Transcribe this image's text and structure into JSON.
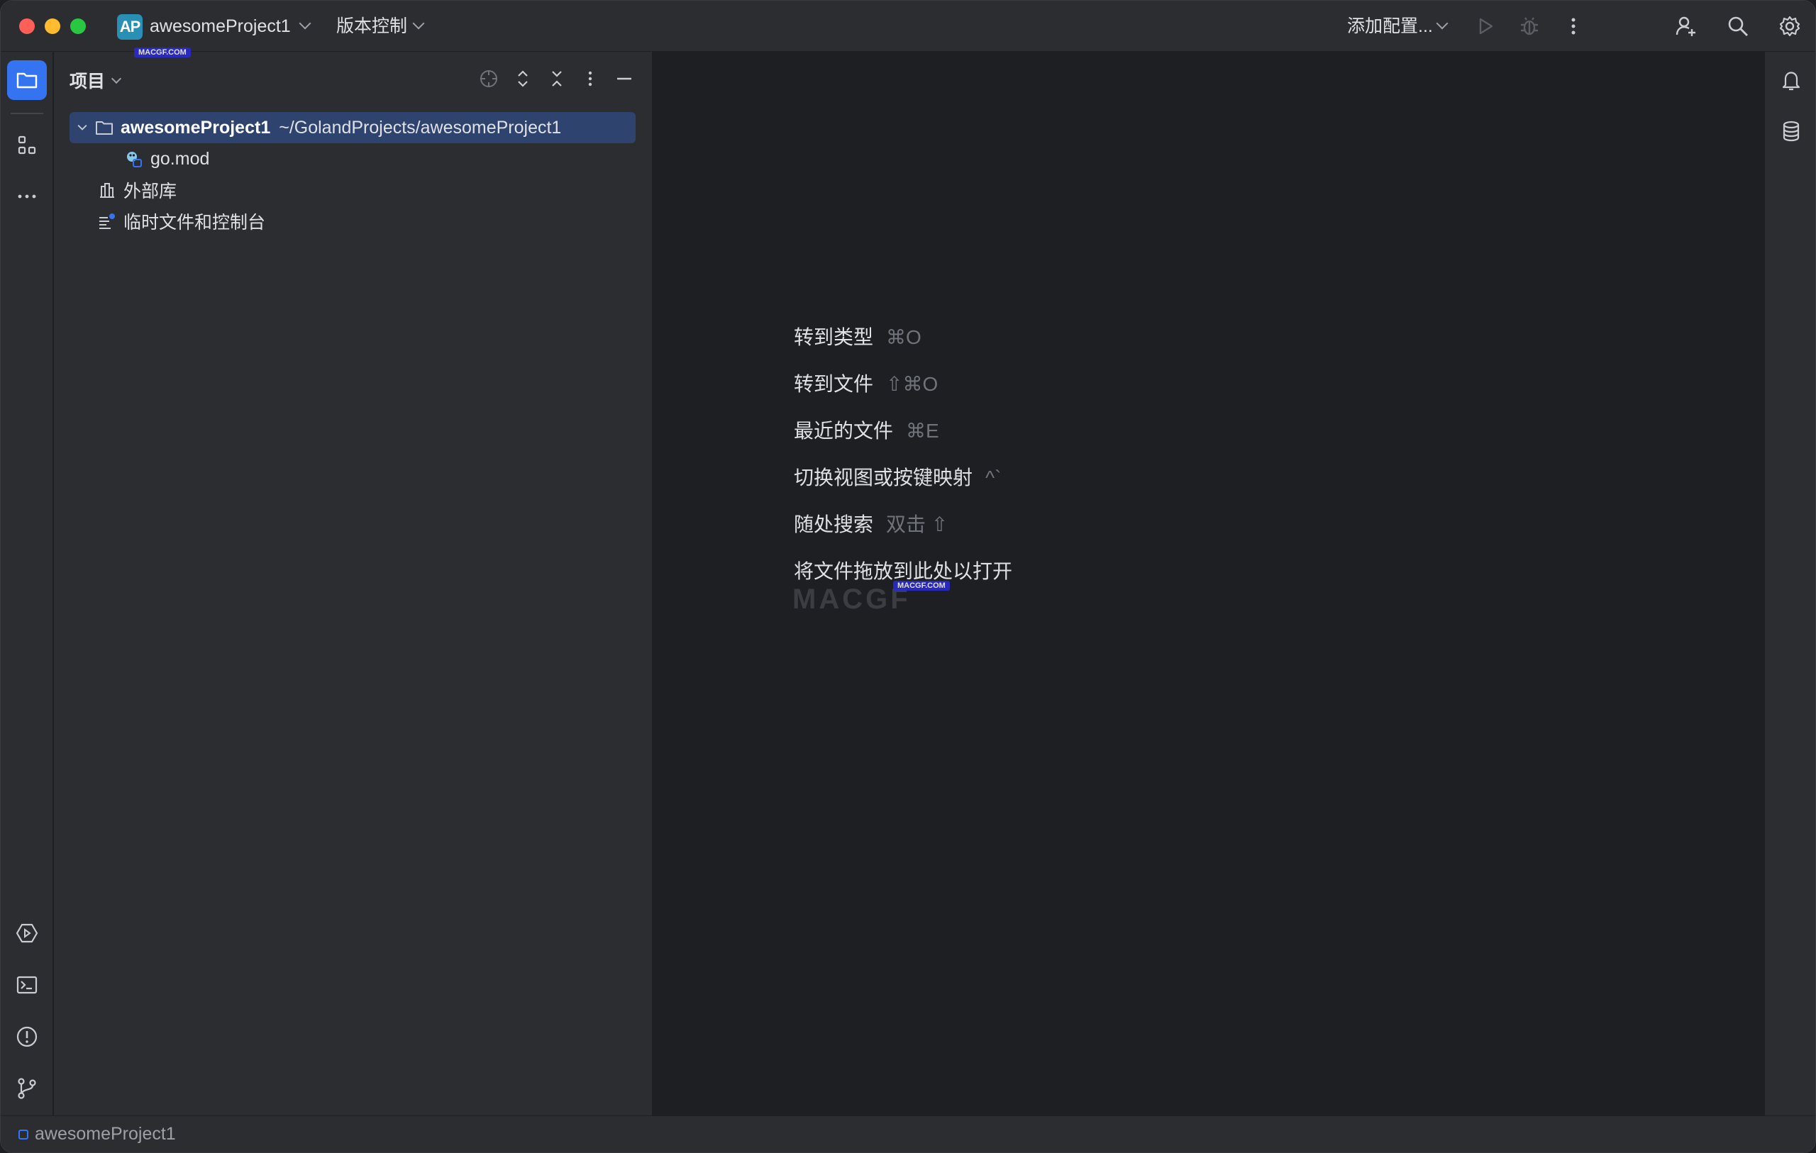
{
  "titlebar": {
    "project_badge": "AP",
    "project_name": "awesomeProject1",
    "vcs_label": "版本控制",
    "run_config": "添加配置..."
  },
  "project_panel": {
    "title": "项目",
    "tree": [
      {
        "name": "awesomeProject1",
        "path": "~/GolandProjects/awesomeProject1",
        "icon": "folder-icon",
        "selected": true
      },
      {
        "name": "go.mod",
        "icon": "go-mod-icon"
      },
      {
        "name": "外部库",
        "icon": "library-icon"
      },
      {
        "name": "临时文件和控制台",
        "icon": "scratch-icon"
      }
    ]
  },
  "editor": {
    "hints": [
      {
        "label": "转到类型",
        "key": "⌘O"
      },
      {
        "label": "转到文件",
        "key": "⇧⌘O"
      },
      {
        "label": "最近的文件",
        "key": "⌘E"
      },
      {
        "label": "切换视图或按键映射",
        "key": "^`"
      },
      {
        "label": "随处搜索",
        "key": "双击 ⇧"
      },
      {
        "label": "将文件拖放到此处以打开",
        "key": ""
      }
    ]
  },
  "watermarks": {
    "top": "MACGF.COM",
    "center": "MACGF.COM",
    "logo": "MACGF"
  },
  "statusbar": {
    "project": "awesomeProject1"
  },
  "colors": {
    "accent": "#3574f0",
    "selection": "#2e436e",
    "background": "#1e1f22",
    "panel": "#2b2d30"
  }
}
